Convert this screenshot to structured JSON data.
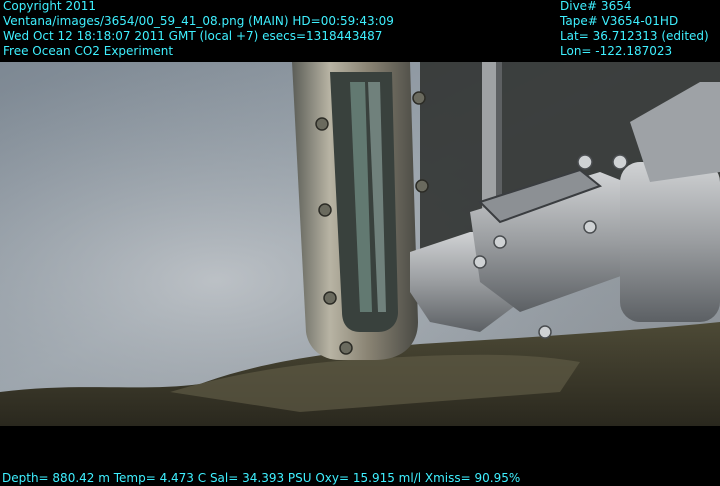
{
  "overlay": {
    "top_left": [
      "Copyright 2011",
      "Ventana/images/3654/00_59_41_08.png (MAIN)  HD=00:59:43:09",
      "Wed Oct 12 18:18:07 2011 GMT (local +7)  esecs=1318443487",
      "Free Ocean CO2 Experiment"
    ],
    "top_right": [
      "Dive# 3654",
      "Tape# V3654-01HD",
      "Lat= 36.712313 (edited)",
      "Lon= -122.187023"
    ],
    "bottom": "Depth= 880.42 m  Temp= 4.473 C  Sal= 34.393 PSU  Oxy= 15.915 ml/l  Xmiss= 90.95%"
  },
  "colors": {
    "overlay_text": "#3ff0ff",
    "letterbox": "#000000",
    "water": "#8f9aa4"
  }
}
